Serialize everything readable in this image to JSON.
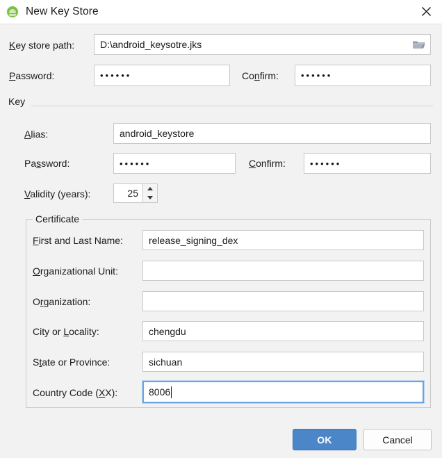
{
  "window": {
    "title": "New Key Store",
    "icon": "android-robot-icon",
    "close_icon": "close-icon"
  },
  "keystore": {
    "path_label": "Key store path:",
    "path_label_mnemonic": "K",
    "path_value": "D:\\android_keysotre.jks",
    "browse_icon": "folder-open-icon",
    "password_label": "Password:",
    "password_label_mnemonic": "P",
    "password_value": "••••••",
    "confirm_label": "Confirm:",
    "confirm_label_mnemonic": "n",
    "confirm_value": "••••••"
  },
  "key_section": {
    "title": "Key",
    "alias_label": "Alias:",
    "alias_label_mnemonic": "A",
    "alias_value": "android_keystore",
    "password_label": "Password:",
    "password_label_mnemonic": "s",
    "password_value": "••••••",
    "confirm_label": "Confirm:",
    "confirm_label_mnemonic": "C",
    "confirm_value": "••••••",
    "validity_label": "Validity (years):",
    "validity_label_mnemonic": "V",
    "validity_value": "25"
  },
  "certificate": {
    "legend": "Certificate",
    "fields": [
      {
        "label": "First and Last Name:",
        "mnemonic": "F",
        "value": "release_signing_dex",
        "focused": false
      },
      {
        "label": "Organizational Unit:",
        "mnemonic": "O",
        "value": "",
        "focused": false
      },
      {
        "label": "Organization:",
        "mnemonic": "r",
        "value": "",
        "focused": false
      },
      {
        "label": "City or Locality:",
        "mnemonic": "L",
        "value": "chengdu",
        "focused": false
      },
      {
        "label": "State or Province:",
        "mnemonic": "t",
        "value": "sichuan",
        "focused": false
      },
      {
        "label": "Country Code (XX):",
        "mnemonic": "X",
        "value": "8006",
        "focused": true
      }
    ]
  },
  "buttons": {
    "ok": "OK",
    "cancel": "Cancel"
  },
  "colors": {
    "dialog_background": "#f2f2f2",
    "titlebar_background": "#ffffff",
    "accent_blue": "#4a86c8",
    "focus_border": "#6aa5e0",
    "field_border": "#c8c8c8",
    "icon_green": "#7ac143"
  }
}
